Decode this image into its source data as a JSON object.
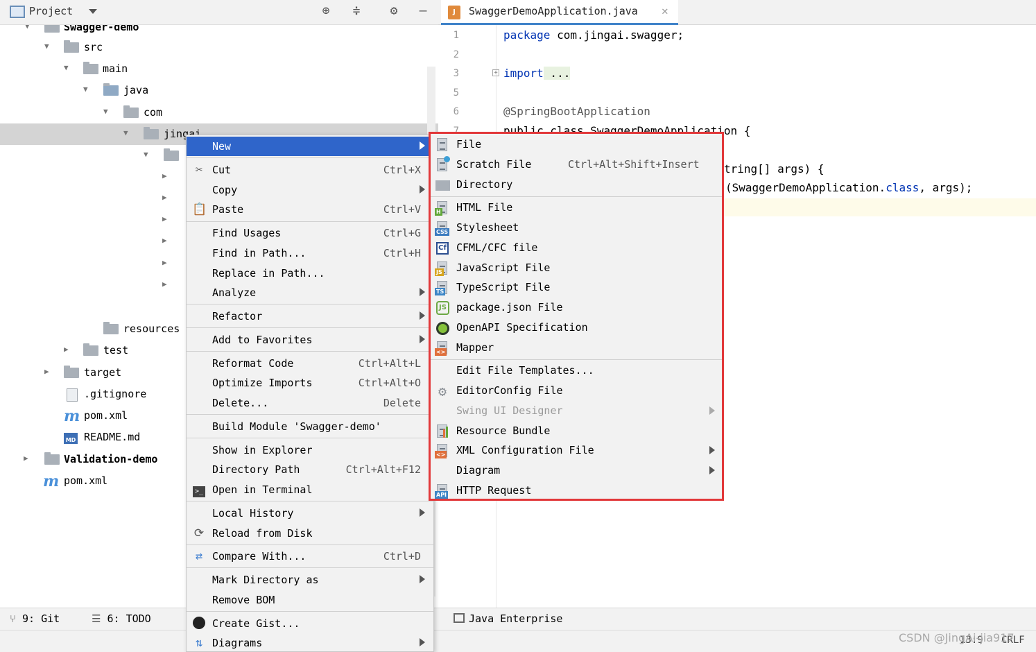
{
  "project_panel": {
    "title": "Project",
    "tree": [
      {
        "label": "Swagger-demo",
        "bold": true
      },
      {
        "label": "src"
      },
      {
        "label": "main"
      },
      {
        "label": "java"
      },
      {
        "label": "com"
      },
      {
        "label": "jingai"
      },
      {
        "label": "resources"
      },
      {
        "label": "test"
      },
      {
        "label": "target"
      },
      {
        "label": ".gitignore"
      },
      {
        "label": "pom.xml"
      },
      {
        "label": "README.md"
      },
      {
        "label": "Validation-demo",
        "bold": true
      },
      {
        "label": "pom.xml"
      }
    ]
  },
  "editor": {
    "tab_label": "SwaggerDemoApplication.java",
    "lines": [
      {
        "num": "1",
        "parts": [
          {
            "kw": "package"
          },
          {
            "text": " com.jingai.swagger;"
          }
        ]
      },
      {
        "num": "2",
        "parts": []
      },
      {
        "num": "3",
        "parts": [
          {
            "kw": "import"
          },
          {
            "text": " ..."
          }
        ]
      },
      {
        "num": "5",
        "parts": []
      },
      {
        "num": "6",
        "parts": [
          {
            "ann": "@SpringBootApplication"
          }
        ]
      },
      {
        "num": "7",
        "parts": [
          {
            "text": "public class SwaggerDemoApplication {"
          }
        ]
      }
    ],
    "visible_fragments": {
      "line9_tail": "tring[] args) {",
      "line10_pre": "(SwaggerDemoApplication.",
      "line10_kw": "class",
      "line10_post": ", args);"
    }
  },
  "context_menu": {
    "items": [
      {
        "label": "New",
        "shortcut": "",
        "submenu": true,
        "active": true
      },
      {
        "label": "Cut",
        "shortcut": "Ctrl+X",
        "icon": "scissors-icon"
      },
      {
        "label": "Copy",
        "shortcut": "",
        "submenu": true
      },
      {
        "label": "Paste",
        "shortcut": "Ctrl+V",
        "icon": "clipboard-icon"
      },
      {
        "label": "Find Usages",
        "shortcut": "Ctrl+G"
      },
      {
        "label": "Find in Path...",
        "shortcut": "Ctrl+H"
      },
      {
        "label": "Replace in Path...",
        "shortcut": ""
      },
      {
        "label": "Analyze",
        "shortcut": "",
        "submenu": true
      },
      {
        "label": "Refactor",
        "shortcut": "",
        "submenu": true
      },
      {
        "label": "Add to Favorites",
        "shortcut": "",
        "submenu": true
      },
      {
        "label": "Reformat Code",
        "shortcut": "Ctrl+Alt+L"
      },
      {
        "label": "Optimize Imports",
        "shortcut": "Ctrl+Alt+O"
      },
      {
        "label": "Delete...",
        "shortcut": "Delete"
      },
      {
        "label": "Build Module 'Swagger-demo'",
        "shortcut": ""
      },
      {
        "label": "Show in Explorer",
        "shortcut": ""
      },
      {
        "label": "Directory Path",
        "shortcut": "Ctrl+Alt+F12"
      },
      {
        "label": "Open in Terminal",
        "shortcut": "",
        "icon": "terminal-icon"
      },
      {
        "label": "Local History",
        "shortcut": "",
        "submenu": true
      },
      {
        "label": "Reload from Disk",
        "shortcut": "",
        "icon": "reload-icon"
      },
      {
        "label": "Compare With...",
        "shortcut": "Ctrl+D",
        "icon": "compare-icon"
      },
      {
        "label": "Mark Directory as",
        "shortcut": "",
        "submenu": true
      },
      {
        "label": "Remove BOM",
        "shortcut": ""
      },
      {
        "label": "Create Gist...",
        "shortcut": "",
        "icon": "github-icon"
      },
      {
        "label": "Diagrams",
        "shortcut": "",
        "submenu": true,
        "icon": "diagram-icon"
      }
    ]
  },
  "new_submenu": {
    "items": [
      {
        "label": "File",
        "icon": "file-icon"
      },
      {
        "label": "Scratch File",
        "shortcut": "Ctrl+Alt+Shift+Insert",
        "icon": "scratch-file-icon"
      },
      {
        "label": "Directory",
        "icon": "folder-icon"
      },
      {
        "label": "HTML File",
        "icon": "html-file-icon",
        "badge": "H",
        "badge_color": "#62a83a"
      },
      {
        "label": "Stylesheet",
        "icon": "css-file-icon",
        "badge": "CSS",
        "badge_color": "#3b7bbf"
      },
      {
        "label": "CFML/CFC file",
        "icon": "cfml-icon"
      },
      {
        "label": "JavaScript File",
        "icon": "js-file-icon",
        "badge": "JS",
        "badge_color": "#d6a51f"
      },
      {
        "label": "TypeScript File",
        "icon": "ts-file-icon",
        "badge": "TS",
        "badge_color": "#3d86c6"
      },
      {
        "label": "package.json File",
        "icon": "nodejs-icon"
      },
      {
        "label": "OpenAPI Specification",
        "icon": "openapi-icon"
      },
      {
        "label": "Mapper",
        "icon": "mapper-icon",
        "badge": "<>",
        "badge_color": "#e0703c"
      },
      {
        "label": "Edit File Templates...",
        "icon": ""
      },
      {
        "label": "EditorConfig File",
        "icon": "gear-icon"
      },
      {
        "label": "Swing UI Designer",
        "disabled": true,
        "submenu": true
      },
      {
        "label": "Resource Bundle",
        "icon": "resource-bundle-icon"
      },
      {
        "label": "XML Configuration File",
        "icon": "xml-file-icon",
        "badge": "<>",
        "badge_color": "#e0703c",
        "submenu": true
      },
      {
        "label": "Diagram",
        "submenu": true
      },
      {
        "label": "HTTP Request",
        "icon": "api-icon",
        "badge": "API",
        "badge_color": "#3d86c6"
      }
    ]
  },
  "bottom_tools": {
    "git": "9: Git",
    "todo": "6: TODO",
    "java_enterprise": "Java Enterprise"
  },
  "status": {
    "position": "13:9",
    "line_ending": "CRLF",
    "watermark": "CSDN @JingAi-jia917"
  },
  "colors": {
    "menu_active": "#2f65ca",
    "highlight_border": "#e2383a",
    "keyword": "#0033b3"
  }
}
